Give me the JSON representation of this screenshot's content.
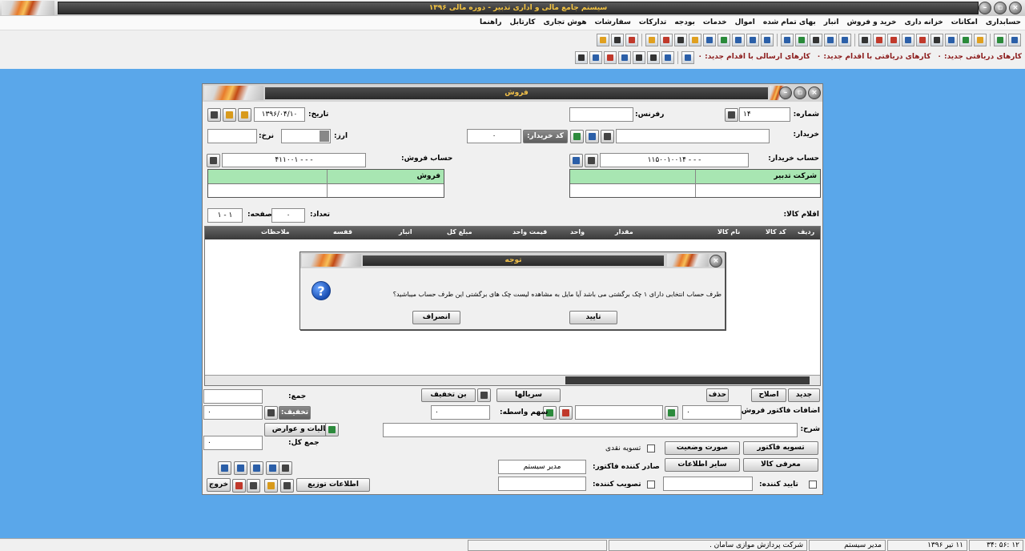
{
  "app": {
    "title": "سیستم جامع مالی و اداری تدبیر - دوره مالی ۱۳۹۶"
  },
  "menu": [
    "حسابداری",
    "امکانات",
    "خزانه داری",
    "خرید و فروش",
    "انبار",
    "بهای تمام شده",
    "اموال",
    "خدمات",
    "بودجه",
    "تدارکات",
    "سفارشات",
    "هوش تجاری",
    "کارتابل",
    "راهنما"
  ],
  "status_messages": {
    "received_new": "کارهای دریافتی جدید: ۰",
    "received_action": "کارهای دریافتی با اقدام جدید: ۰",
    "sent_action": "کارهای ارسالی با اقدام جدید: ۰"
  },
  "form": {
    "title": "فروش",
    "number_label": "شماره:",
    "number_value": "۱۴",
    "ref_label": "رفرنس:",
    "ref_value": "",
    "date_label": "تاریخ:",
    "date_value": "۱۳۹۶/۰۴/۱۰",
    "buyer_label": "خریدار:",
    "buyer_value": "",
    "buyer_code_button": "کد خریدار:",
    "buyer_code_value": "۰",
    "currency_label": "ارز:",
    "currency_value": "",
    "rate_label": "نرخ:",
    "rate_value": "",
    "buyer_account_label": "حساب خریدار:",
    "buyer_account_value": "۱۱۵۰۰۱۰۰۱۴ - - -",
    "sale_account_label": "حساب فروش:",
    "sale_account_value": "۴۱۱۰۰۱ - - -",
    "buyer_box_title": "شرکت تدبیر",
    "sale_box_title": "فروش",
    "items_label": "اقلام کالا:",
    "count_label": "تعداد:",
    "count_value": "۰",
    "page_label": "صفحه:",
    "page_value": "۱ - ۱",
    "columns": [
      "ردیف",
      "کد کالا",
      "نام کالا",
      "مقدار",
      "واحد",
      "قیمت واحد",
      "مبلغ کل",
      "انبار",
      "قفسه",
      "ملاحظات"
    ],
    "btn_new": "جدید",
    "btn_edit": "اصلاح",
    "btn_delete": "حذف",
    "btn_serials": "سریالها",
    "btn_discount_coupon": "بن تخفیف",
    "sum_label": "جمع:",
    "sum_value": "",
    "additions_label": "اضافات فاکتور فروش:",
    "additions_value": "۰",
    "broker_share_label": "سهم واسطه:",
    "broker_share_value": "۰",
    "discount_button": "تخفیف:",
    "discount_value": "۰",
    "tax_button": "مالیات و عوارض",
    "total_label": "جمع کل:",
    "total_value": "۰",
    "description_label": "شرح:",
    "description_value": "",
    "settle_invoice": "تسویه فاکتور",
    "status_report": "صورت وضعیت",
    "cash_settle": "تسویه نقدی",
    "introduce_goods": "معرفی کالا",
    "other_info": "سایر اطلاعات",
    "issuer_label": "صادر کننده فاکتور:",
    "issuer_value": "مدیر سیستم",
    "approver_label": "تصویب کننده:",
    "confirmer_label": "تایید کننده:",
    "distribution_info": "اطلاعات توزیع",
    "exit": "خروج"
  },
  "dialog": {
    "title": "توجه",
    "message": "طرف حساب انتخابی دارای ۱ چک برگشتی می باشد آیا مایل به مشاهده لیست چک های برگشتی این طرف حساب میباشید؟",
    "confirm": "تایید",
    "cancel": "انصراف"
  },
  "statusbar": {
    "company": "شرکت پردازش موازی سامان .",
    "user": "مدیر سیستم",
    "date": "۱۱ تیر ۱۳۹۶",
    "time": "۱۲ :۵۶ :۳۴"
  }
}
